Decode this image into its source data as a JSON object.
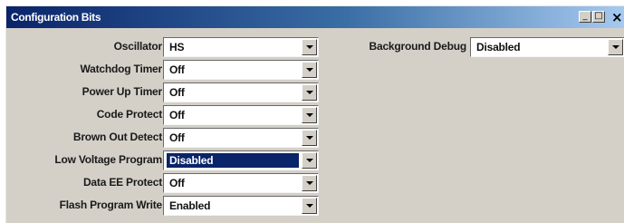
{
  "window": {
    "title": "Configuration Bits",
    "controls": {
      "minimize": "_",
      "maximize": "□",
      "close": "×"
    }
  },
  "settings": [
    {
      "label": "Oscillator",
      "value": "HS"
    },
    {
      "label": "Watchdog Timer",
      "value": "Off"
    },
    {
      "label": "Power Up Timer",
      "value": "Off"
    },
    {
      "label": "Code Protect",
      "value": "Off"
    },
    {
      "label": "Brown Out Detect",
      "value": "Off"
    },
    {
      "label": "Low Voltage Program",
      "value": "Disabled"
    },
    {
      "label": "Data EE Protect",
      "value": "Off"
    },
    {
      "label": "Flash Program Write",
      "value": "Enabled"
    },
    {
      "label": "Background Debug",
      "value": "Disabled"
    }
  ],
  "colors": {
    "titlebar_start": "#0a246a",
    "titlebar_end": "#a6caf0",
    "selection": "#0a246a",
    "face": "#d4d0c8"
  }
}
